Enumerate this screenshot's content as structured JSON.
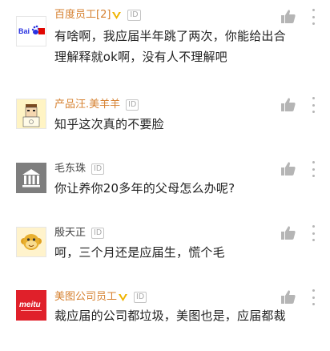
{
  "comments": [
    {
      "name": "百度员工[2]",
      "highlight": true,
      "verified": true,
      "id_tag": "ID",
      "text": "有啥啊，我应届半年跳了两次，你能给出合理解释就ok啊，没有人不理解吧",
      "avatar": "baidu-logo"
    },
    {
      "name": "产品汪.美羊羊",
      "highlight": true,
      "verified": false,
      "id_tag": "ID",
      "text": "知乎这次真的不要脸",
      "avatar": "cartoon-person"
    },
    {
      "name": "毛东珠",
      "highlight": false,
      "verified": false,
      "id_tag": "ID",
      "text": "你让养你20多年的父母怎么办呢?",
      "avatar": "bank-building"
    },
    {
      "name": "殷天正",
      "highlight": false,
      "verified": false,
      "id_tag": "ID",
      "text": "呵，三个月还是应届生，慌个毛",
      "avatar": "monkey-face"
    },
    {
      "name": "美图公司员工",
      "highlight": true,
      "verified": true,
      "id_tag": "ID",
      "text": "裁应届的公司都垃圾，美图也是，应届都裁",
      "avatar": "meitu-logo"
    }
  ],
  "baidu_logo_text": "Bai",
  "meitu_logo_text": "meitu",
  "colors": {
    "highlight_name": "#d6802f",
    "badge": "#f0b400",
    "icon_gray": "#b5b5b5"
  }
}
